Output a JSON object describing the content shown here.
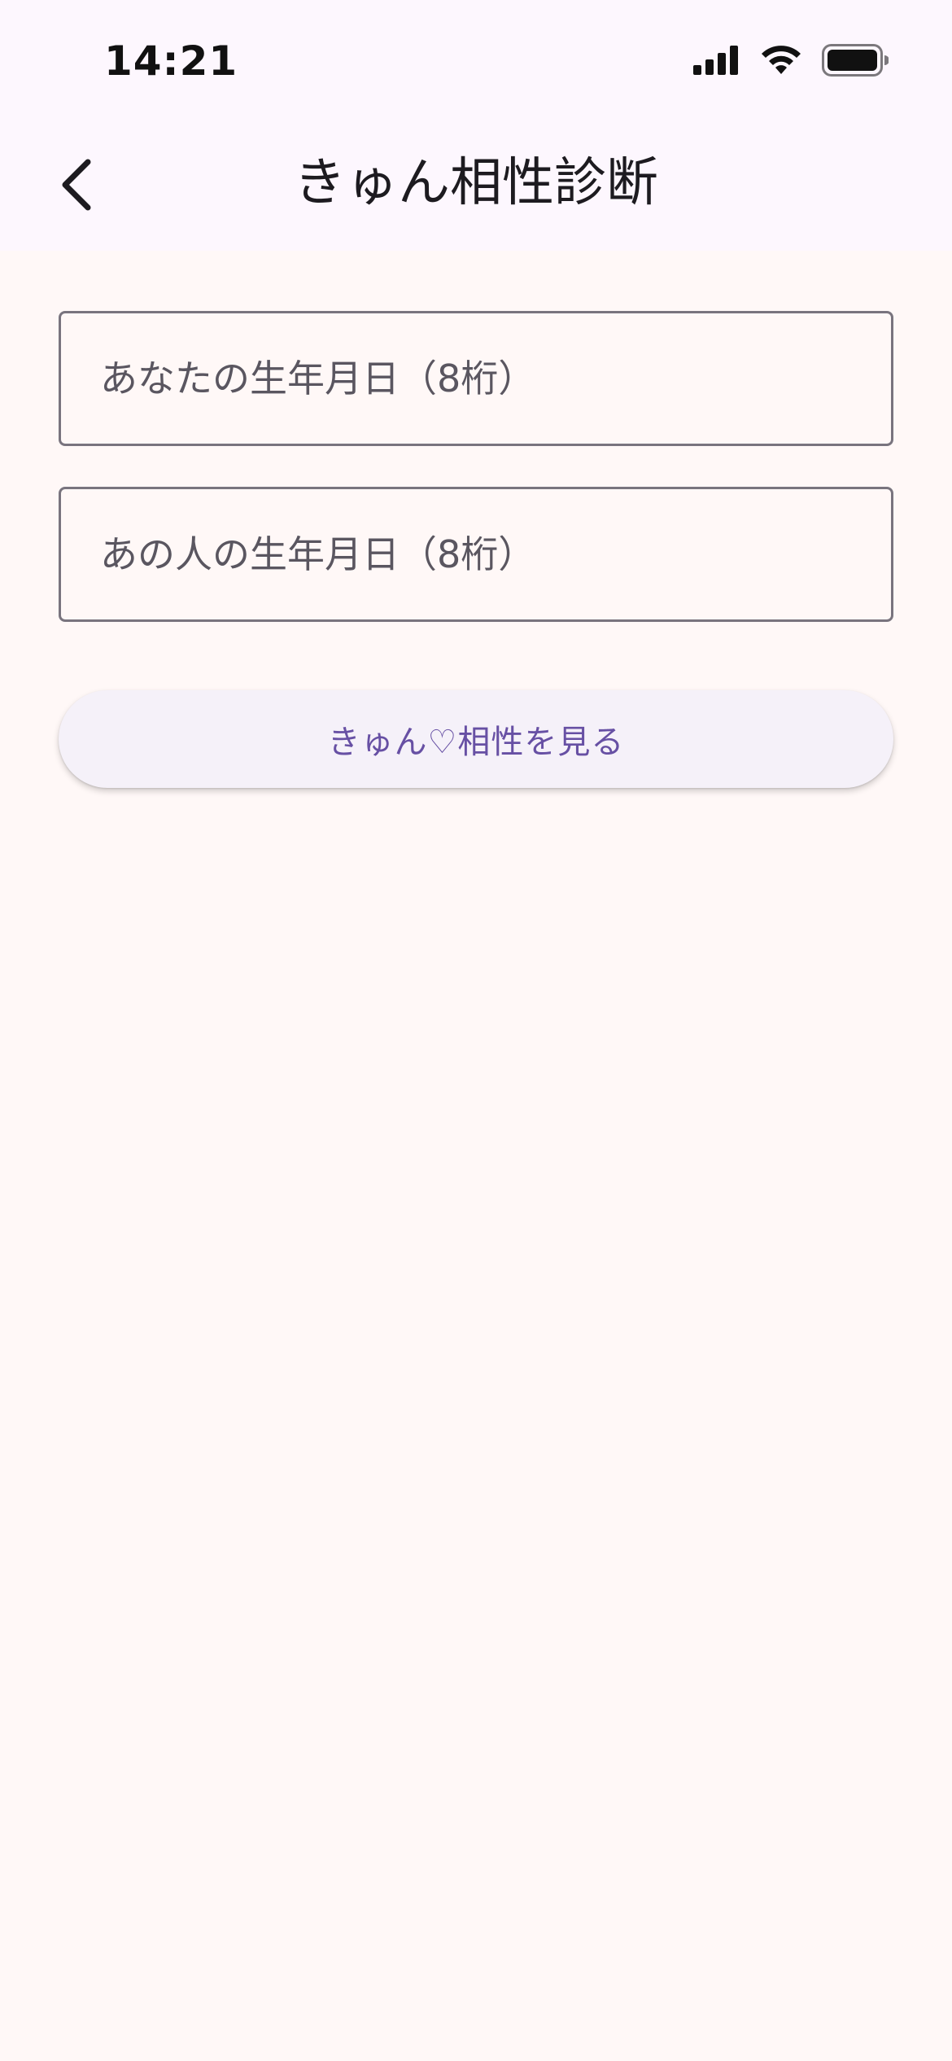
{
  "status_bar": {
    "time": "14:21",
    "icons": [
      "cellular-signal-icon",
      "wifi-icon",
      "battery-icon"
    ]
  },
  "app_bar": {
    "back_icon": "chevron-left-icon",
    "title": "きゅん相性診断"
  },
  "form": {
    "your_birthday": {
      "value": "",
      "placeholder": "あなたの生年月日（8桁）"
    },
    "partner_birthday": {
      "value": "",
      "placeholder": "あの人の生年月日（8桁）"
    },
    "submit_label": "きゅん♡相性を見る"
  },
  "colors": {
    "background": "#fff8f7",
    "app_bar": "#fdf7fe",
    "outline": "#79747e",
    "accent": "#6750a4",
    "button_surface": "#f5f1f9"
  }
}
